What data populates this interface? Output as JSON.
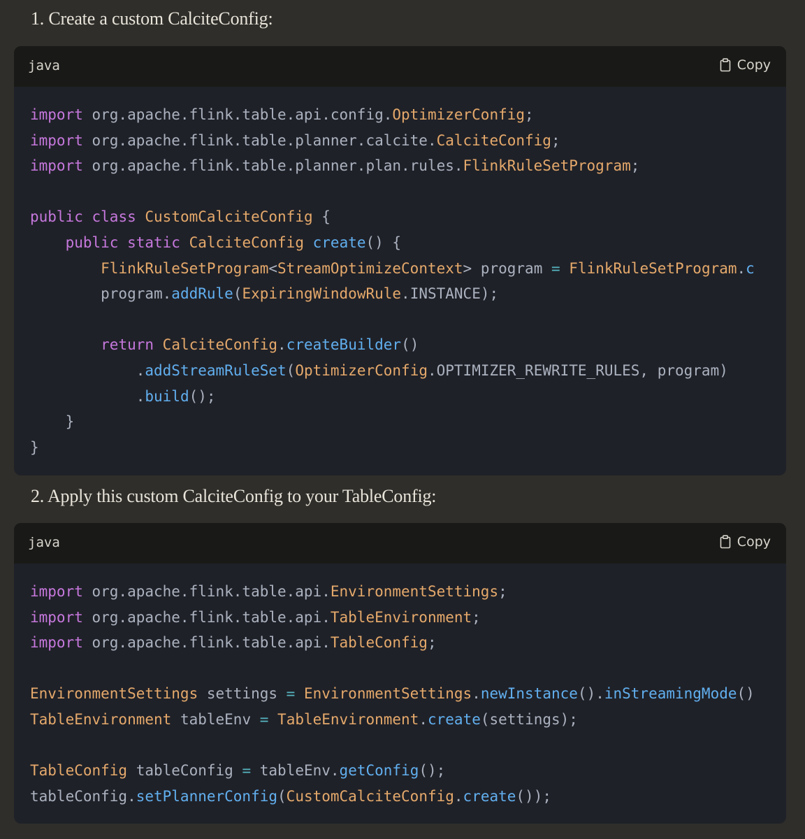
{
  "steps": [
    {
      "text": "1. Create a custom CalciteConfig:"
    },
    {
      "text": "2. Apply this custom CalciteConfig to your TableConfig:"
    }
  ],
  "colors": {
    "page_bg": "#2f2e2a",
    "code_bg": "#1f2128",
    "header_bg": "#191917",
    "keyword": "#c678dd",
    "type": "#e5a96b",
    "function": "#61afef",
    "operator": "#56b6c2",
    "plain": "#abb2bf"
  },
  "code_blocks": [
    {
      "language": "java",
      "copy_label": "Copy",
      "copy_icon": "clipboard-icon",
      "lines": [
        [
          [
            "k",
            "import"
          ],
          [
            "p",
            " org.apache.flink.table.api.config."
          ],
          [
            "t",
            "OptimizerConfig"
          ],
          [
            "p",
            ";"
          ]
        ],
        [
          [
            "k",
            "import"
          ],
          [
            "p",
            " org.apache.flink.table.planner.calcite."
          ],
          [
            "t",
            "CalciteConfig"
          ],
          [
            "p",
            ";"
          ]
        ],
        [
          [
            "k",
            "import"
          ],
          [
            "p",
            " org.apache.flink.table.planner.plan.rules."
          ],
          [
            "t",
            "FlinkRuleSetProgram"
          ],
          [
            "p",
            ";"
          ]
        ],
        [],
        [
          [
            "k",
            "public"
          ],
          [
            "p",
            " "
          ],
          [
            "k",
            "class"
          ],
          [
            "p",
            " "
          ],
          [
            "t",
            "CustomCalciteConfig"
          ],
          [
            "p",
            " {"
          ]
        ],
        [
          [
            "p",
            "    "
          ],
          [
            "k",
            "public"
          ],
          [
            "p",
            " "
          ],
          [
            "k",
            "static"
          ],
          [
            "p",
            " "
          ],
          [
            "t",
            "CalciteConfig"
          ],
          [
            "p",
            " "
          ],
          [
            "f",
            "create"
          ],
          [
            "p",
            "() {"
          ]
        ],
        [
          [
            "p",
            "        "
          ],
          [
            "t",
            "FlinkRuleSetProgram"
          ],
          [
            "p",
            "<"
          ],
          [
            "t",
            "StreamOptimizeContext"
          ],
          [
            "p",
            "> program "
          ],
          [
            "o",
            "="
          ],
          [
            "p",
            " "
          ],
          [
            "t",
            "FlinkRuleSetProgram"
          ],
          [
            "p",
            "."
          ],
          [
            "f",
            "c"
          ]
        ],
        [
          [
            "p",
            "        program."
          ],
          [
            "f",
            "addRule"
          ],
          [
            "p",
            "("
          ],
          [
            "t",
            "ExpiringWindowRule"
          ],
          [
            "p",
            ".INSTANCE);"
          ]
        ],
        [],
        [
          [
            "p",
            "        "
          ],
          [
            "k",
            "return"
          ],
          [
            "p",
            " "
          ],
          [
            "t",
            "CalciteConfig"
          ],
          [
            "p",
            "."
          ],
          [
            "f",
            "createBuilder"
          ],
          [
            "p",
            "()"
          ]
        ],
        [
          [
            "p",
            "            ."
          ],
          [
            "f",
            "addStreamRuleSet"
          ],
          [
            "p",
            "("
          ],
          [
            "t",
            "OptimizerConfig"
          ],
          [
            "p",
            ".OPTIMIZER_REWRITE_RULES, program)"
          ]
        ],
        [
          [
            "p",
            "            ."
          ],
          [
            "f",
            "build"
          ],
          [
            "p",
            "();"
          ]
        ],
        [
          [
            "p",
            "    }"
          ]
        ],
        [
          [
            "p",
            "}"
          ]
        ]
      ]
    },
    {
      "language": "java",
      "copy_label": "Copy",
      "copy_icon": "clipboard-icon",
      "lines": [
        [
          [
            "k",
            "import"
          ],
          [
            "p",
            " org.apache.flink.table.api."
          ],
          [
            "t",
            "EnvironmentSettings"
          ],
          [
            "p",
            ";"
          ]
        ],
        [
          [
            "k",
            "import"
          ],
          [
            "p",
            " org.apache.flink.table.api."
          ],
          [
            "t",
            "TableEnvironment"
          ],
          [
            "p",
            ";"
          ]
        ],
        [
          [
            "k",
            "import"
          ],
          [
            "p",
            " org.apache.flink.table.api."
          ],
          [
            "t",
            "TableConfig"
          ],
          [
            "p",
            ";"
          ]
        ],
        [],
        [
          [
            "t",
            "EnvironmentSettings"
          ],
          [
            "p",
            " settings "
          ],
          [
            "o",
            "="
          ],
          [
            "p",
            " "
          ],
          [
            "t",
            "EnvironmentSettings"
          ],
          [
            "p",
            "."
          ],
          [
            "f",
            "newInstance"
          ],
          [
            "p",
            "()."
          ],
          [
            "f",
            "inStreamingMode"
          ],
          [
            "p",
            "()"
          ]
        ],
        [
          [
            "t",
            "TableEnvironment"
          ],
          [
            "p",
            " tableEnv "
          ],
          [
            "o",
            "="
          ],
          [
            "p",
            " "
          ],
          [
            "t",
            "TableEnvironment"
          ],
          [
            "p",
            "."
          ],
          [
            "f",
            "create"
          ],
          [
            "p",
            "(settings);"
          ]
        ],
        [],
        [
          [
            "t",
            "TableConfig"
          ],
          [
            "p",
            " tableConfig "
          ],
          [
            "o",
            "="
          ],
          [
            "p",
            " tableEnv."
          ],
          [
            "f",
            "getConfig"
          ],
          [
            "p",
            "();"
          ]
        ],
        [
          [
            "p",
            "tableConfig."
          ],
          [
            "f",
            "setPlannerConfig"
          ],
          [
            "p",
            "("
          ],
          [
            "t",
            "CustomCalciteConfig"
          ],
          [
            "p",
            "."
          ],
          [
            "f",
            "create"
          ],
          [
            "p",
            "());"
          ]
        ]
      ]
    }
  ]
}
